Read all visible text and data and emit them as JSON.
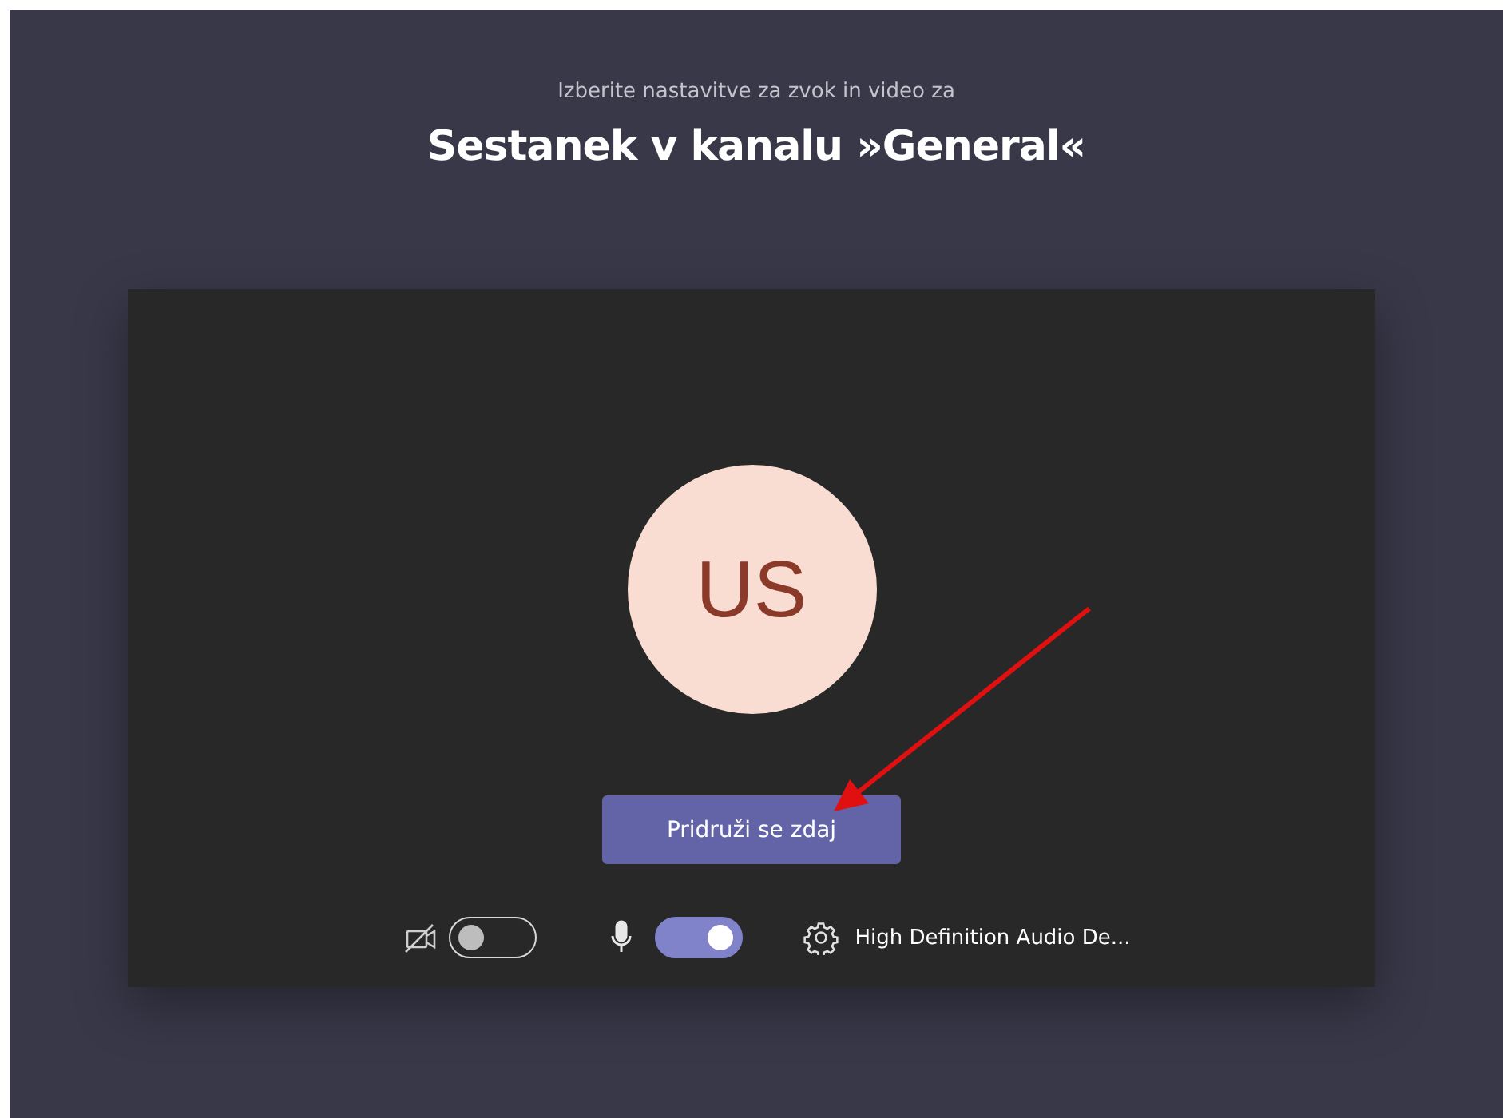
{
  "header": {
    "subtitle": "Izberite nastavitve za zvok in video za",
    "title": "Sestanek v kanalu »General«"
  },
  "preview": {
    "avatar_initials": "US",
    "join_button": "Pridruži se zdaj"
  },
  "controls": {
    "camera": {
      "on": false
    },
    "microphone": {
      "on": true
    },
    "device": "High Definition Audio De..."
  }
}
